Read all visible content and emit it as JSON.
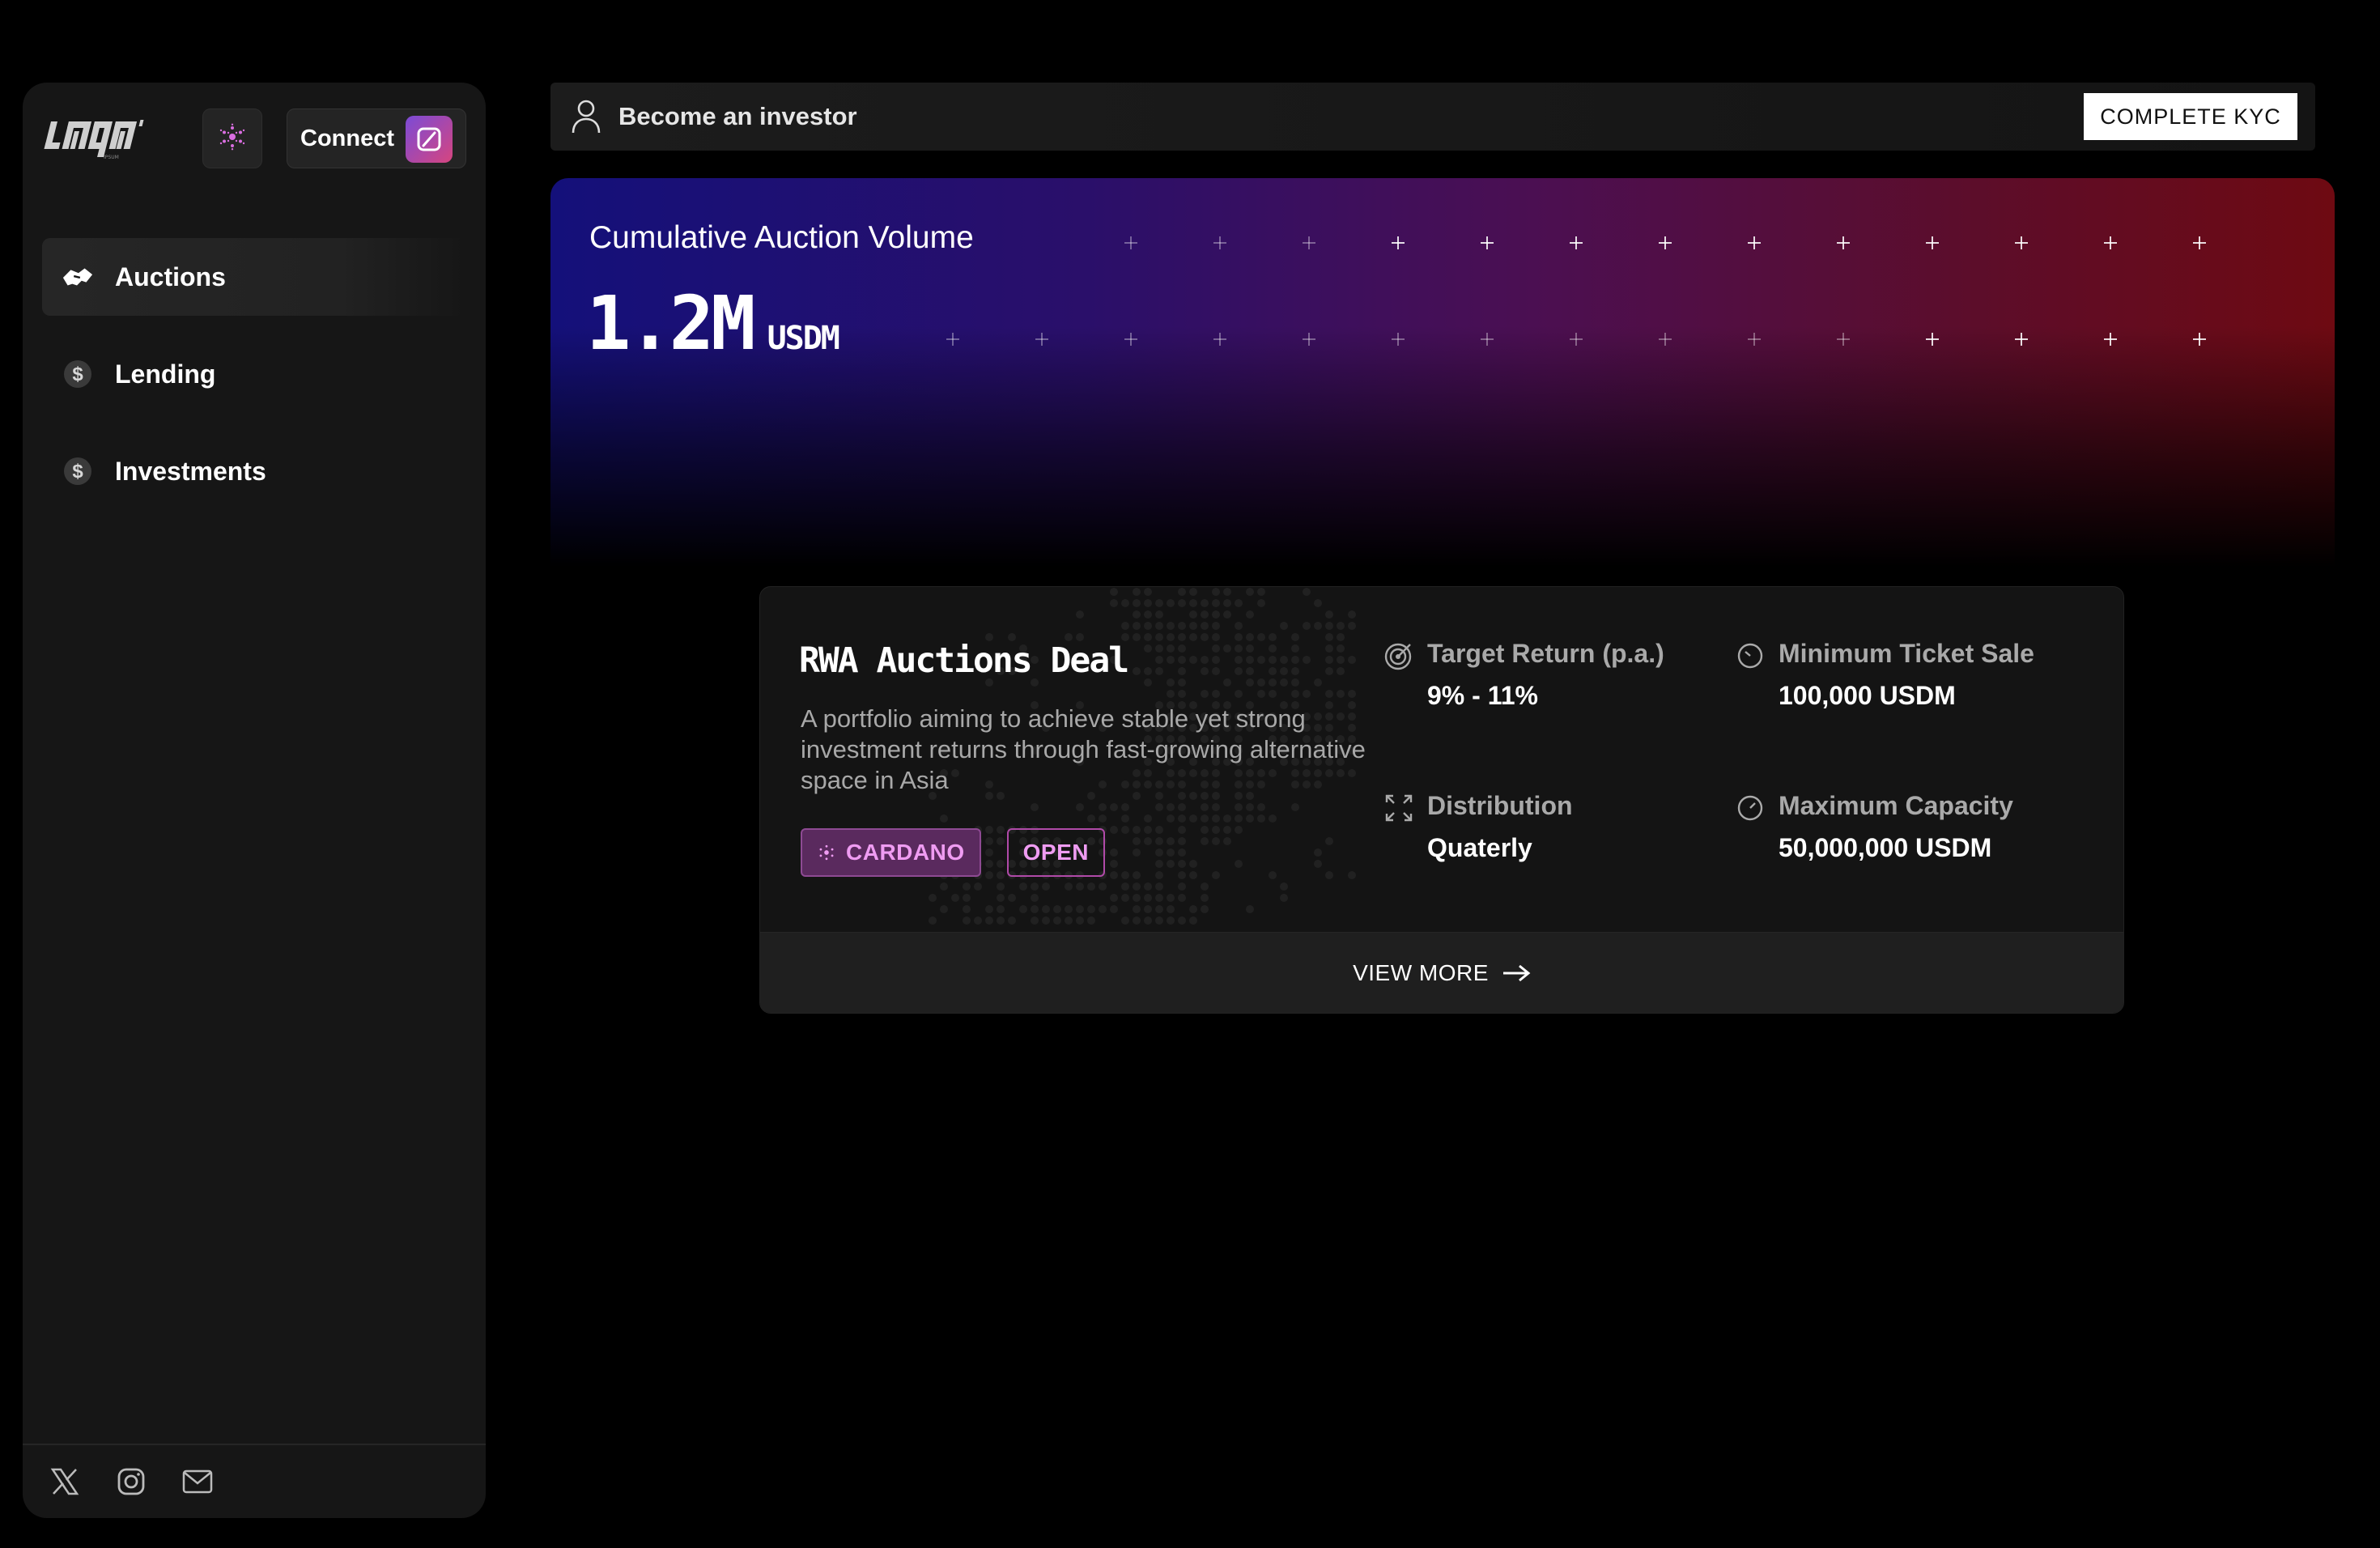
{
  "sidebar": {
    "connect_label": "Connect",
    "nav": [
      {
        "label": "Auctions",
        "icon": "handshake-icon",
        "active": true
      },
      {
        "label": "Lending",
        "icon": "dollar-coin-icon",
        "active": false
      },
      {
        "label": "Investments",
        "icon": "dollar-coin-icon",
        "active": false
      }
    ],
    "footer_icons": [
      "x-twitter-icon",
      "instagram-icon",
      "mail-icon"
    ]
  },
  "investor_banner": {
    "text": "Become an investor",
    "kyc_button": "COMPLETE KYC"
  },
  "hero": {
    "title": "Cumulative Auction Volume",
    "value": "1.2M",
    "unit": "USDM"
  },
  "deal": {
    "title": "RWA Auctions Deal",
    "description": "A portfolio aiming to achieve stable yet strong investment returns through fast-growing alternative space in Asia",
    "tags": {
      "chain": "CARDANO",
      "status": "OPEN"
    },
    "stats": [
      {
        "label": "Target Return (p.a.)",
        "value": "9% - 11%",
        "icon": "target-icon"
      },
      {
        "label": "Minimum Ticket Sale",
        "value": "100,000 USDM",
        "icon": "gauge-min-icon"
      },
      {
        "label": "Distribution",
        "value": "Quaterly",
        "icon": "expand-icon"
      },
      {
        "label": "Maximum Capacity",
        "value": "50,000,000 USDM",
        "icon": "gauge-max-icon"
      }
    ],
    "view_more": "VIEW MORE"
  },
  "colors": {
    "accent_pink": "#ef9cf2",
    "hero_left": "#14107a",
    "hero_right": "#6e0a12"
  }
}
